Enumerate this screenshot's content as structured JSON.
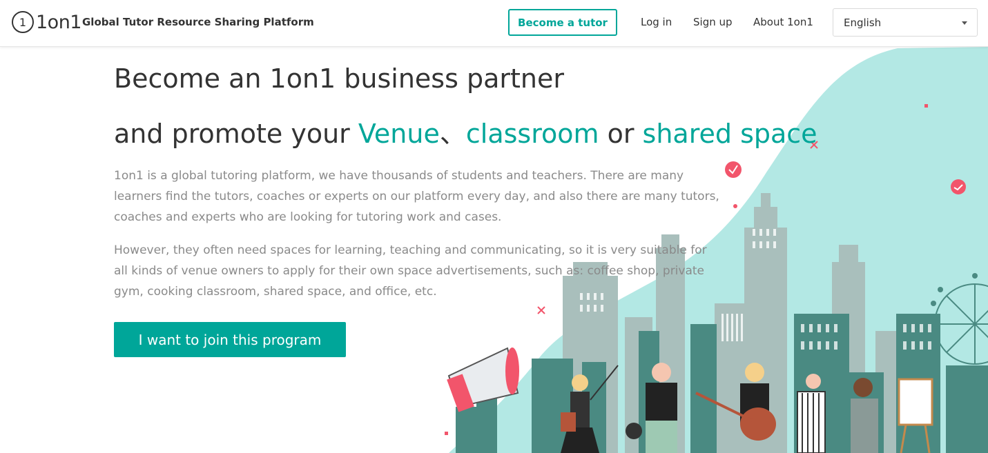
{
  "header": {
    "logo_text": "1on1",
    "tagline": "Global Tutor Resource Sharing Platform",
    "become_tutor_label": "Become a tutor",
    "nav": {
      "login": "Log in",
      "signup": "Sign up",
      "about": "About 1on1"
    },
    "language": {
      "selected": "English",
      "icon": "chevron-down-icon"
    }
  },
  "hero": {
    "title_line1": "Become an 1on1 business partner",
    "title_line2_prefix": "and promote your ",
    "highlight_venue": "Venue",
    "separator": "、",
    "highlight_classroom": "classroom",
    "connector": " or ",
    "highlight_shared": "shared space",
    "paragraph1": "1on1 is a global tutoring platform, we have thousands of students and teachers. There are many learners find the tutors, coaches or experts on our platform every day, and also there are many tutors, coaches and experts who are looking for tutoring work and cases.",
    "paragraph2": "However, they often need spaces for learning, teaching and communicating, so it is very suitable for all kinds of venue owners to apply for their own space advertisements, such as: coffee shop, private gym, cooking classroom, shared space, and office, etc.",
    "cta_label": "I want to join this program"
  },
  "colors": {
    "accent": "#00a699",
    "blob": "#b3e8e4",
    "building_dark": "#4a8a82",
    "building_light": "#a9bfbc",
    "pink": "#f2556b"
  },
  "illustration": {
    "icons": [
      "city-skyline",
      "ferris-wheel",
      "megaphone-icon",
      "tutor-characters"
    ]
  }
}
